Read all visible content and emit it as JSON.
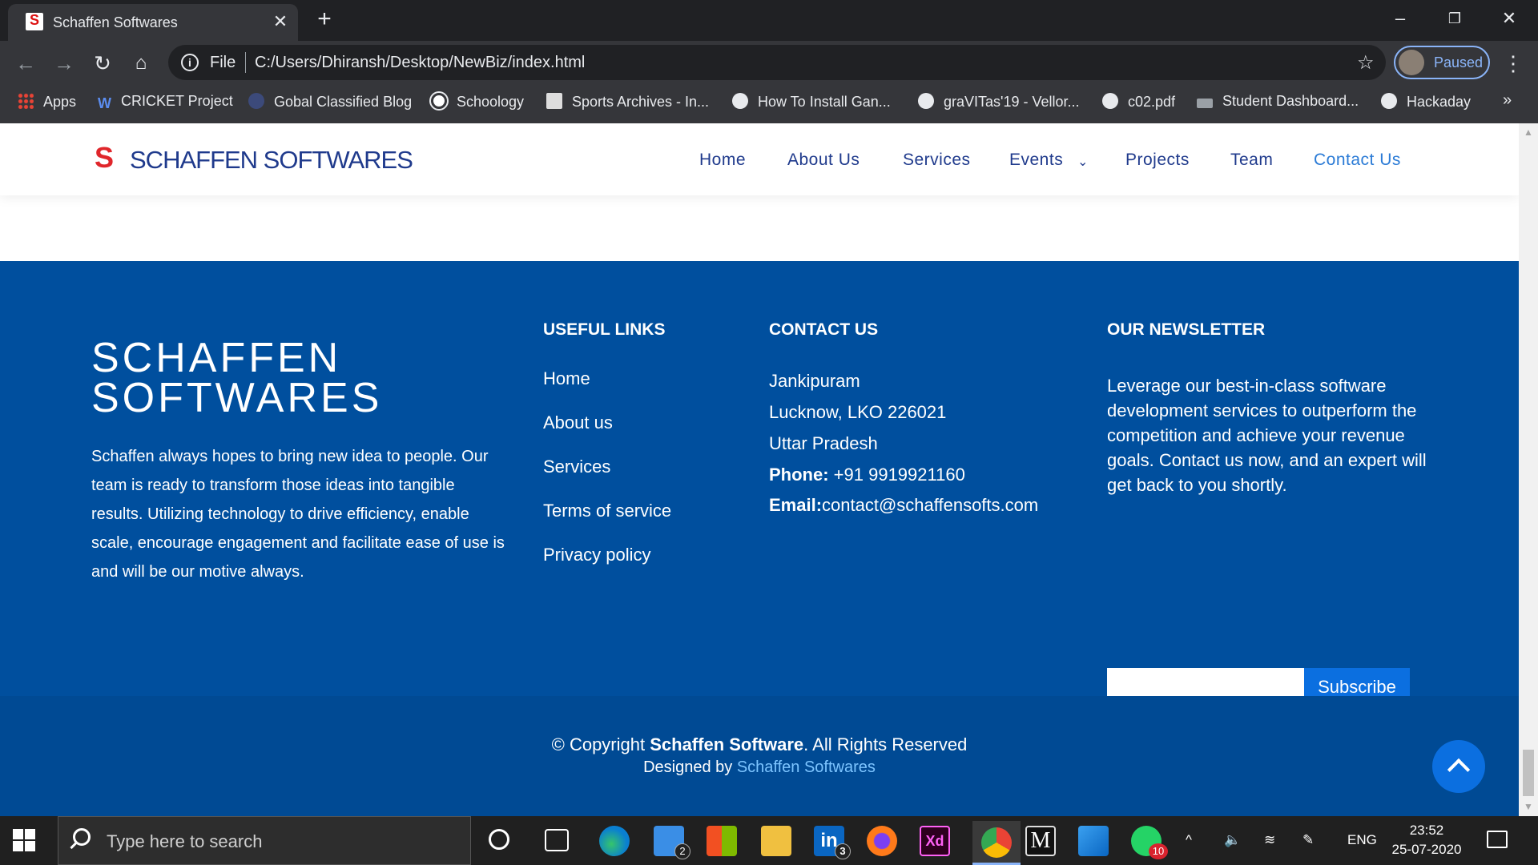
{
  "browser": {
    "tab_title": "Schaffen Softwares",
    "scheme_label": "File",
    "url": "C:/Users/Dhiransh/Desktop/NewBiz/index.html",
    "profile_status": "Paused",
    "bookmarks": [
      "Apps",
      "CRICKET Project",
      "Gobal Classified Blog",
      "Schoology",
      "Sports Archives - In...",
      "How To Install Gan...",
      "graVITas'19 - Vellor...",
      "c02.pdf",
      "Student Dashboard...",
      "Hackaday"
    ],
    "more_bookmarks": "»"
  },
  "header": {
    "logo_text": "SCHAFFEN SOFTWARES",
    "nav": [
      "Home",
      "About Us",
      "Services",
      "Events",
      "Projects",
      "Team",
      "Contact Us"
    ],
    "active_nav": "Contact Us"
  },
  "footer": {
    "brand_line1": "SCHAFFEN",
    "brand_line2": "SOFTWARES",
    "about": "Schaffen always hopes to bring new idea to people. Our team is ready to transform those ideas into tangible results. Utilizing technology to drive efficiency, enable scale, encourage engagement and facilitate ease of use is and will be our motive always.",
    "useful_links_title": "USEFUL LINKS",
    "useful_links": [
      "Home",
      "About us",
      "Services",
      "Terms of service",
      "Privacy policy"
    ],
    "contact_title": "CONTACT US",
    "address_line1": "Jankipuram",
    "address_line2": "Lucknow, LKO 226021",
    "address_line3": "Uttar Pradesh",
    "phone_label": "Phone:",
    "phone": " +91 9919921160",
    "email_label": "Email:",
    "email": "contact@schaffensofts.com",
    "social_icons": [
      "twitter-icon",
      "facebook-icon",
      "instagram-icon",
      "youtube-icon",
      "linkedin-icon"
    ],
    "newsletter_title": "OUR NEWSLETTER",
    "newsletter_text": "Leverage our best-in-class software development services to outperform the competition and achieve your revenue goals. Contact us now, and an expert will get back to you shortly.",
    "newsletter_input_value": "",
    "subscribe_label": "Subscribe",
    "copyright_prefix": "© Copyright ",
    "copyright_company": "Schaffen Software",
    "copyright_suffix": ". All Rights Reserved",
    "designed_by_prefix": "Designed by ",
    "designed_by_name": "Schaffen Softwares"
  },
  "taskbar": {
    "search_placeholder": "Type here to search",
    "mail_badge": "2",
    "linkedin_badge": "3",
    "whatsapp_badge": "10",
    "language": "ENG",
    "time": "23:52",
    "date": "25-07-2020"
  },
  "colors": {
    "footer_blue": "#004f9e",
    "accent_blue": "#0b6fe0",
    "logo_red": "#e0262b",
    "nav_text": "#1f3a8c"
  }
}
